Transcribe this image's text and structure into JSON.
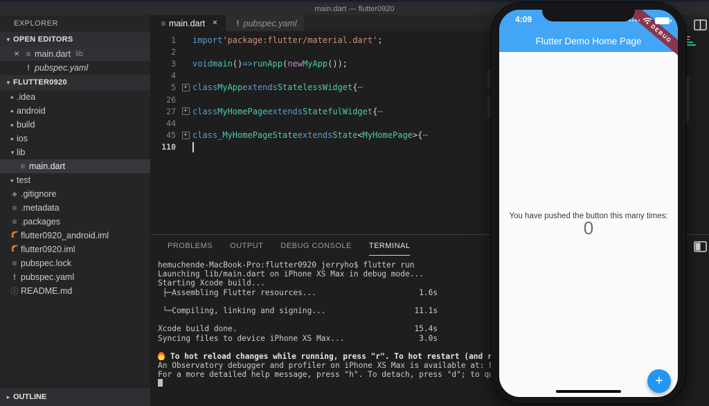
{
  "window": {
    "title": "main.dart — flutter0920"
  },
  "colors": {
    "app_bar_blue": "#42A5F5",
    "fab_blue": "#2196F3",
    "debug_banner_red": "#8D2E44",
    "keyword": "#569CD6",
    "type": "#4EC9B0",
    "string": "#CE9178",
    "new_kw": "#C586C0",
    "iml_icon_orange": "#E37933",
    "info_icon_blue": "#519ABA",
    "warning_icon_purple": "#C586C0"
  },
  "sidebar": {
    "explorer_label": "EXPLORER",
    "open_editors": {
      "label": "OPEN EDITORS",
      "items": [
        {
          "label": "main.dart",
          "detail": "lib",
          "icon": "file-icon",
          "close": "✕",
          "active": true,
          "italic": false
        },
        {
          "label": "pubspec.yaml",
          "detail": "",
          "icon": "warning-icon",
          "close": "",
          "active": false,
          "italic": true
        }
      ]
    },
    "project": {
      "label": "FLUTTER0920",
      "items": [
        {
          "label": ".idea",
          "kind": "folder",
          "arrow": "▸",
          "level": 1
        },
        {
          "label": "android",
          "kind": "folder",
          "arrow": "▸",
          "level": 1
        },
        {
          "label": "build",
          "kind": "folder",
          "arrow": "▸",
          "level": 1
        },
        {
          "label": "ios",
          "kind": "folder",
          "arrow": "▸",
          "level": 1
        },
        {
          "label": "lib",
          "kind": "folder",
          "arrow": "▾",
          "level": 1
        },
        {
          "label": "main.dart",
          "kind": "file",
          "icon": "file-icon",
          "level": 2,
          "selected": true
        },
        {
          "label": "test",
          "kind": "folder",
          "arrow": "▸",
          "level": 1
        },
        {
          "label": ".gitignore",
          "kind": "file",
          "icon": "git-icon",
          "level": 1
        },
        {
          "label": ".metadata",
          "kind": "file",
          "icon": "file-icon",
          "level": 1
        },
        {
          "label": ".packages",
          "kind": "file",
          "icon": "file-icon",
          "level": 1
        },
        {
          "label": "flutter0920_android.iml",
          "kind": "file",
          "icon": "rss-icon",
          "level": 1
        },
        {
          "label": "flutter0920.iml",
          "kind": "file",
          "icon": "rss-icon",
          "level": 1
        },
        {
          "label": "pubspec.lock",
          "kind": "file",
          "icon": "file-icon",
          "level": 1
        },
        {
          "label": "pubspec.yaml",
          "kind": "file",
          "icon": "warning-icon",
          "level": 1
        },
        {
          "label": "README.md",
          "kind": "file",
          "icon": "info-icon",
          "level": 1
        }
      ]
    },
    "outline_label": "OUTLINE"
  },
  "tabs": [
    {
      "label": "main.dart",
      "icon": "file-icon",
      "active": true,
      "close": "✕",
      "italic": false
    },
    {
      "label": "pubspec.yaml",
      "icon": "warning-icon",
      "active": false,
      "close": "",
      "italic": true
    }
  ],
  "editor": {
    "lines": [
      {
        "num": "1",
        "tokens": [
          [
            "import",
            "kw"
          ],
          [
            " ",
            "pt"
          ],
          [
            "'package:flutter/material.dart'",
            "str"
          ],
          [
            ";",
            "pt"
          ]
        ]
      },
      {
        "num": "2",
        "tokens": []
      },
      {
        "num": "3",
        "tokens": [
          [
            "void",
            "kw"
          ],
          [
            " ",
            "pt"
          ],
          [
            "main",
            "fn"
          ],
          [
            "() ",
            "pt"
          ],
          [
            "=>",
            "kw"
          ],
          [
            " ",
            "pt"
          ],
          [
            "runApp",
            "fn"
          ],
          [
            "(",
            "pt"
          ],
          [
            "new",
            "ctl"
          ],
          [
            " ",
            "pt"
          ],
          [
            "MyApp",
            "type"
          ],
          [
            "());",
            "pt"
          ]
        ]
      },
      {
        "num": "4",
        "tokens": []
      },
      {
        "num": "5",
        "fold": true,
        "tokens": [
          [
            "class",
            "kw"
          ],
          [
            " ",
            "pt"
          ],
          [
            "MyApp",
            "type"
          ],
          [
            " ",
            "pt"
          ],
          [
            "extends",
            "kw"
          ],
          [
            " ",
            "pt"
          ],
          [
            "StatelessWidget",
            "type"
          ],
          [
            " {",
            "pt"
          ],
          [
            " ⋯",
            "fold"
          ]
        ]
      },
      {
        "num": "26",
        "tokens": []
      },
      {
        "num": "27",
        "fold": true,
        "tokens": [
          [
            "class",
            "kw"
          ],
          [
            " ",
            "pt"
          ],
          [
            "MyHomePage",
            "type"
          ],
          [
            " ",
            "pt"
          ],
          [
            "extends",
            "kw"
          ],
          [
            " ",
            "pt"
          ],
          [
            "StatefulWidget",
            "type"
          ],
          [
            " {",
            "pt"
          ],
          [
            " ⋯",
            "fold"
          ]
        ]
      },
      {
        "num": "44",
        "tokens": []
      },
      {
        "num": "45",
        "fold": true,
        "tokens": [
          [
            "class",
            "kw"
          ],
          [
            " ",
            "pt"
          ],
          [
            "_MyHomePageState",
            "type"
          ],
          [
            " ",
            "pt"
          ],
          [
            "extends",
            "kw"
          ],
          [
            " ",
            "pt"
          ],
          [
            "State",
            "type"
          ],
          [
            "<",
            "pt"
          ],
          [
            "MyHomePage",
            "type"
          ],
          [
            ">",
            "pt"
          ],
          [
            " {",
            "pt"
          ],
          [
            " ⋯",
            "fold"
          ]
        ]
      },
      {
        "num": "110",
        "cursor": true,
        "tokens": []
      }
    ]
  },
  "panel": {
    "tabs": [
      {
        "label": "PROBLEMS",
        "active": false
      },
      {
        "label": "OUTPUT",
        "active": false
      },
      {
        "label": "DEBUG CONSOLE",
        "active": false
      },
      {
        "label": "TERMINAL",
        "active": true
      }
    ],
    "terminal_lines": [
      {
        "text": "hemuchende-MacBook-Pro:flutter0920 jerryho$ flutter run"
      },
      {
        "text": "Launching lib/main.dart on iPhone XS Max in debug mode..."
      },
      {
        "text": "Starting Xcode build..."
      },
      {
        "text": " ├─Assembling Flutter resources...                      1.6s"
      },
      {
        "text": ""
      },
      {
        "text": " └─Compiling, linking and signing...                   11.1s"
      },
      {
        "text": ""
      },
      {
        "text": "Xcode build done.                                      15.4s"
      },
      {
        "text": "Syncing files to device iPhone XS Max...                3.0s"
      },
      {
        "text": ""
      },
      {
        "text": "To hot reload changes while running, press \"r\". To hot restart (and re",
        "bold": true,
        "fire": true
      },
      {
        "text": "An Observatory debugger and profiler on iPhone XS Max is available at: ht"
      },
      {
        "text": "For a more detailed help message, press \"h\". To detach, press \"d\"; to qui"
      },
      {
        "text": "",
        "cursor": true
      }
    ]
  },
  "phone": {
    "status_time": "4:09",
    "app_bar_title": "Flutter Demo Home Page",
    "debug_banner": "DEBUG",
    "body_text": "You have pushed the button this many times:",
    "counter": "0",
    "fab_label": "+"
  },
  "icons": {
    "right_edge_top": "split-editor-icon",
    "right_edge_bottom": "toggle-panel-icon",
    "status": [
      "cellular-dots-icon",
      "wifi-icon",
      "battery-icon"
    ],
    "terminal_note": "flame-icon"
  }
}
